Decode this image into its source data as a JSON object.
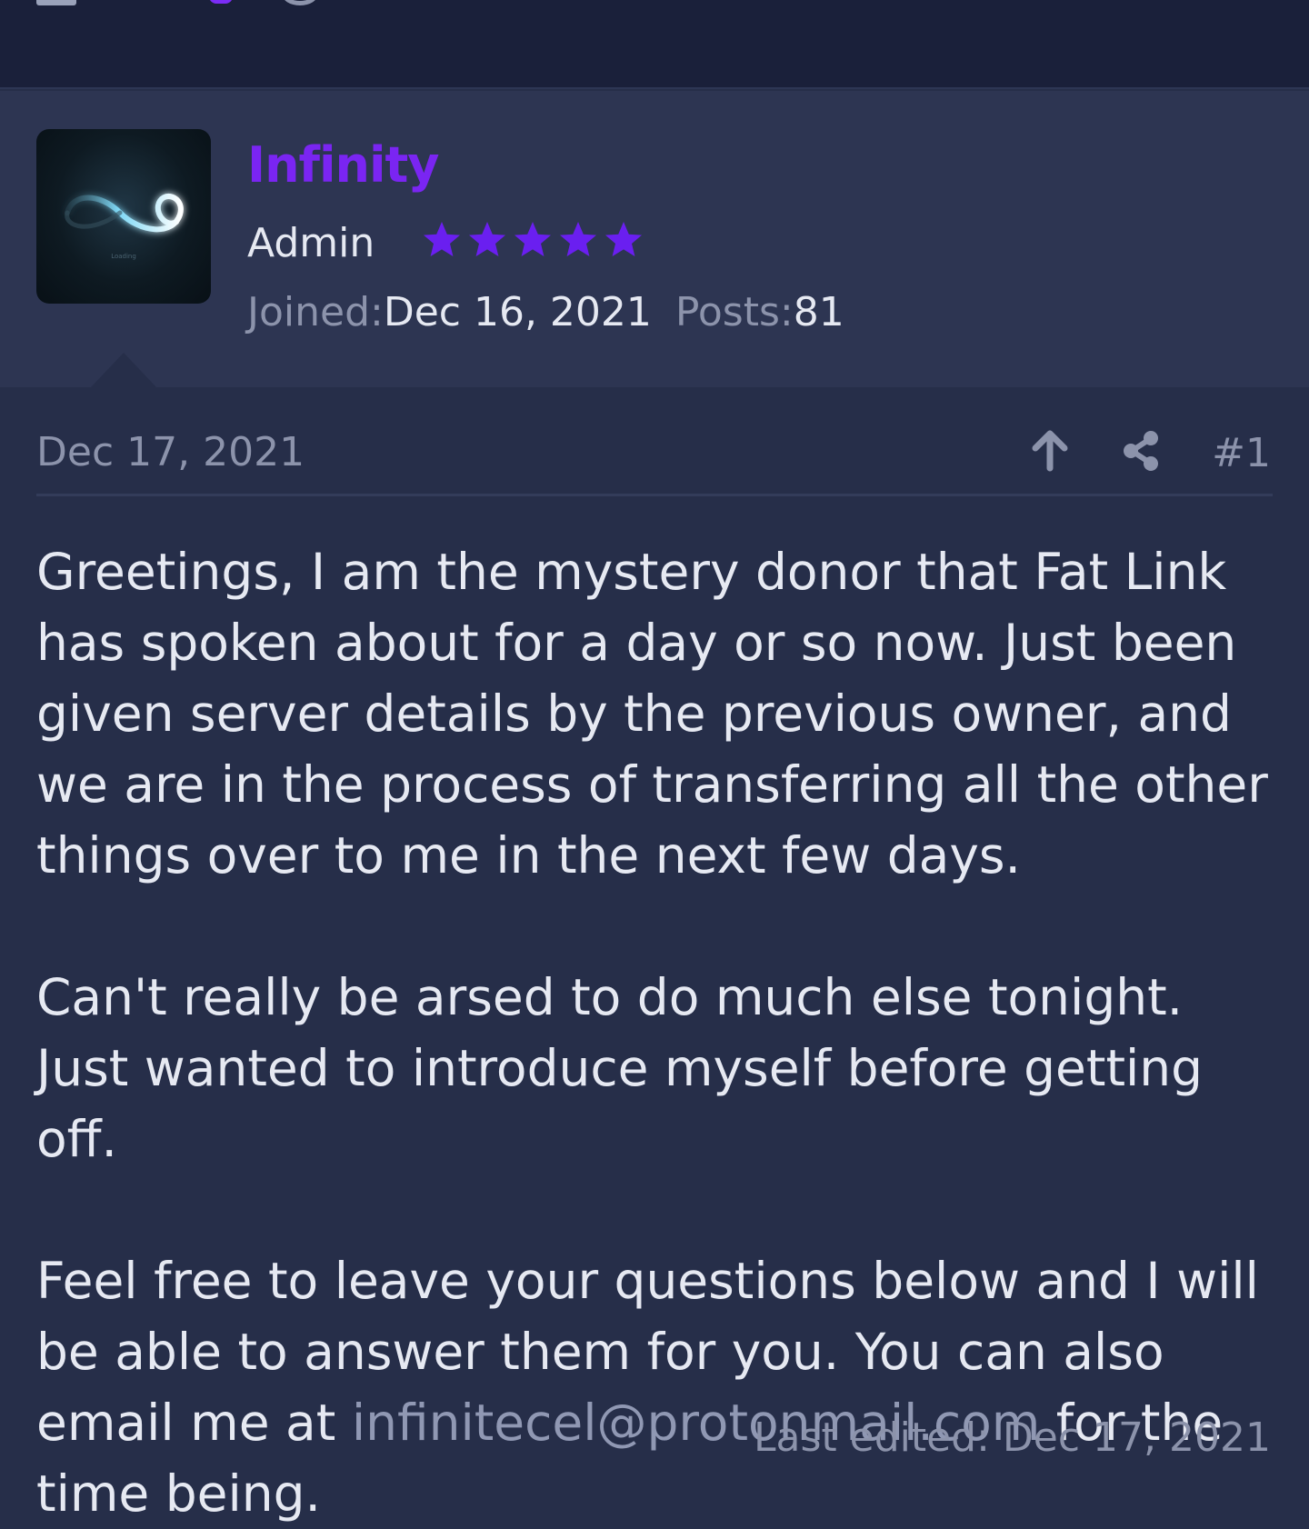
{
  "colors": {
    "page_bg": "#262e49",
    "topbar_bg": "#1a203a",
    "user_block_bg": "#2d3552",
    "username": "#7a25f2",
    "stars": "#6a1ff0",
    "muted_text": "#8c93ab",
    "body_text": "#e6e9f2"
  },
  "user": {
    "name": "Infinity",
    "role": "Admin",
    "star_count": 5,
    "avatar_icon": "infinity-logo",
    "avatar_caption": "Loading",
    "joined_label": "Joined:",
    "joined_value": "Dec 16, 2021",
    "posts_label": "Posts:",
    "posts_value": "81"
  },
  "post": {
    "date": "Dec 17, 2021",
    "number": "#1",
    "actions": [
      "upvote-icon",
      "share-icon"
    ],
    "paragraph1": "Greetings, I am the mystery donor that Fat Link has spoken about for a day or so now. Just been given server details by the previous owner, and we are in the process of transferring all the other things over to me in the next few days.",
    "paragraph2": "Can't really be arsed to do much else tonight. Just wanted to introduce myself before getting off.",
    "paragraph3_before": "Feel free to leave your questions below and I will be able to answer them for you. You can also email me at ",
    "email": "infinitecel@protonmail.com",
    "paragraph3_after": " for the time being.",
    "last_edited": "Last edited: Dec 17, 2021"
  }
}
